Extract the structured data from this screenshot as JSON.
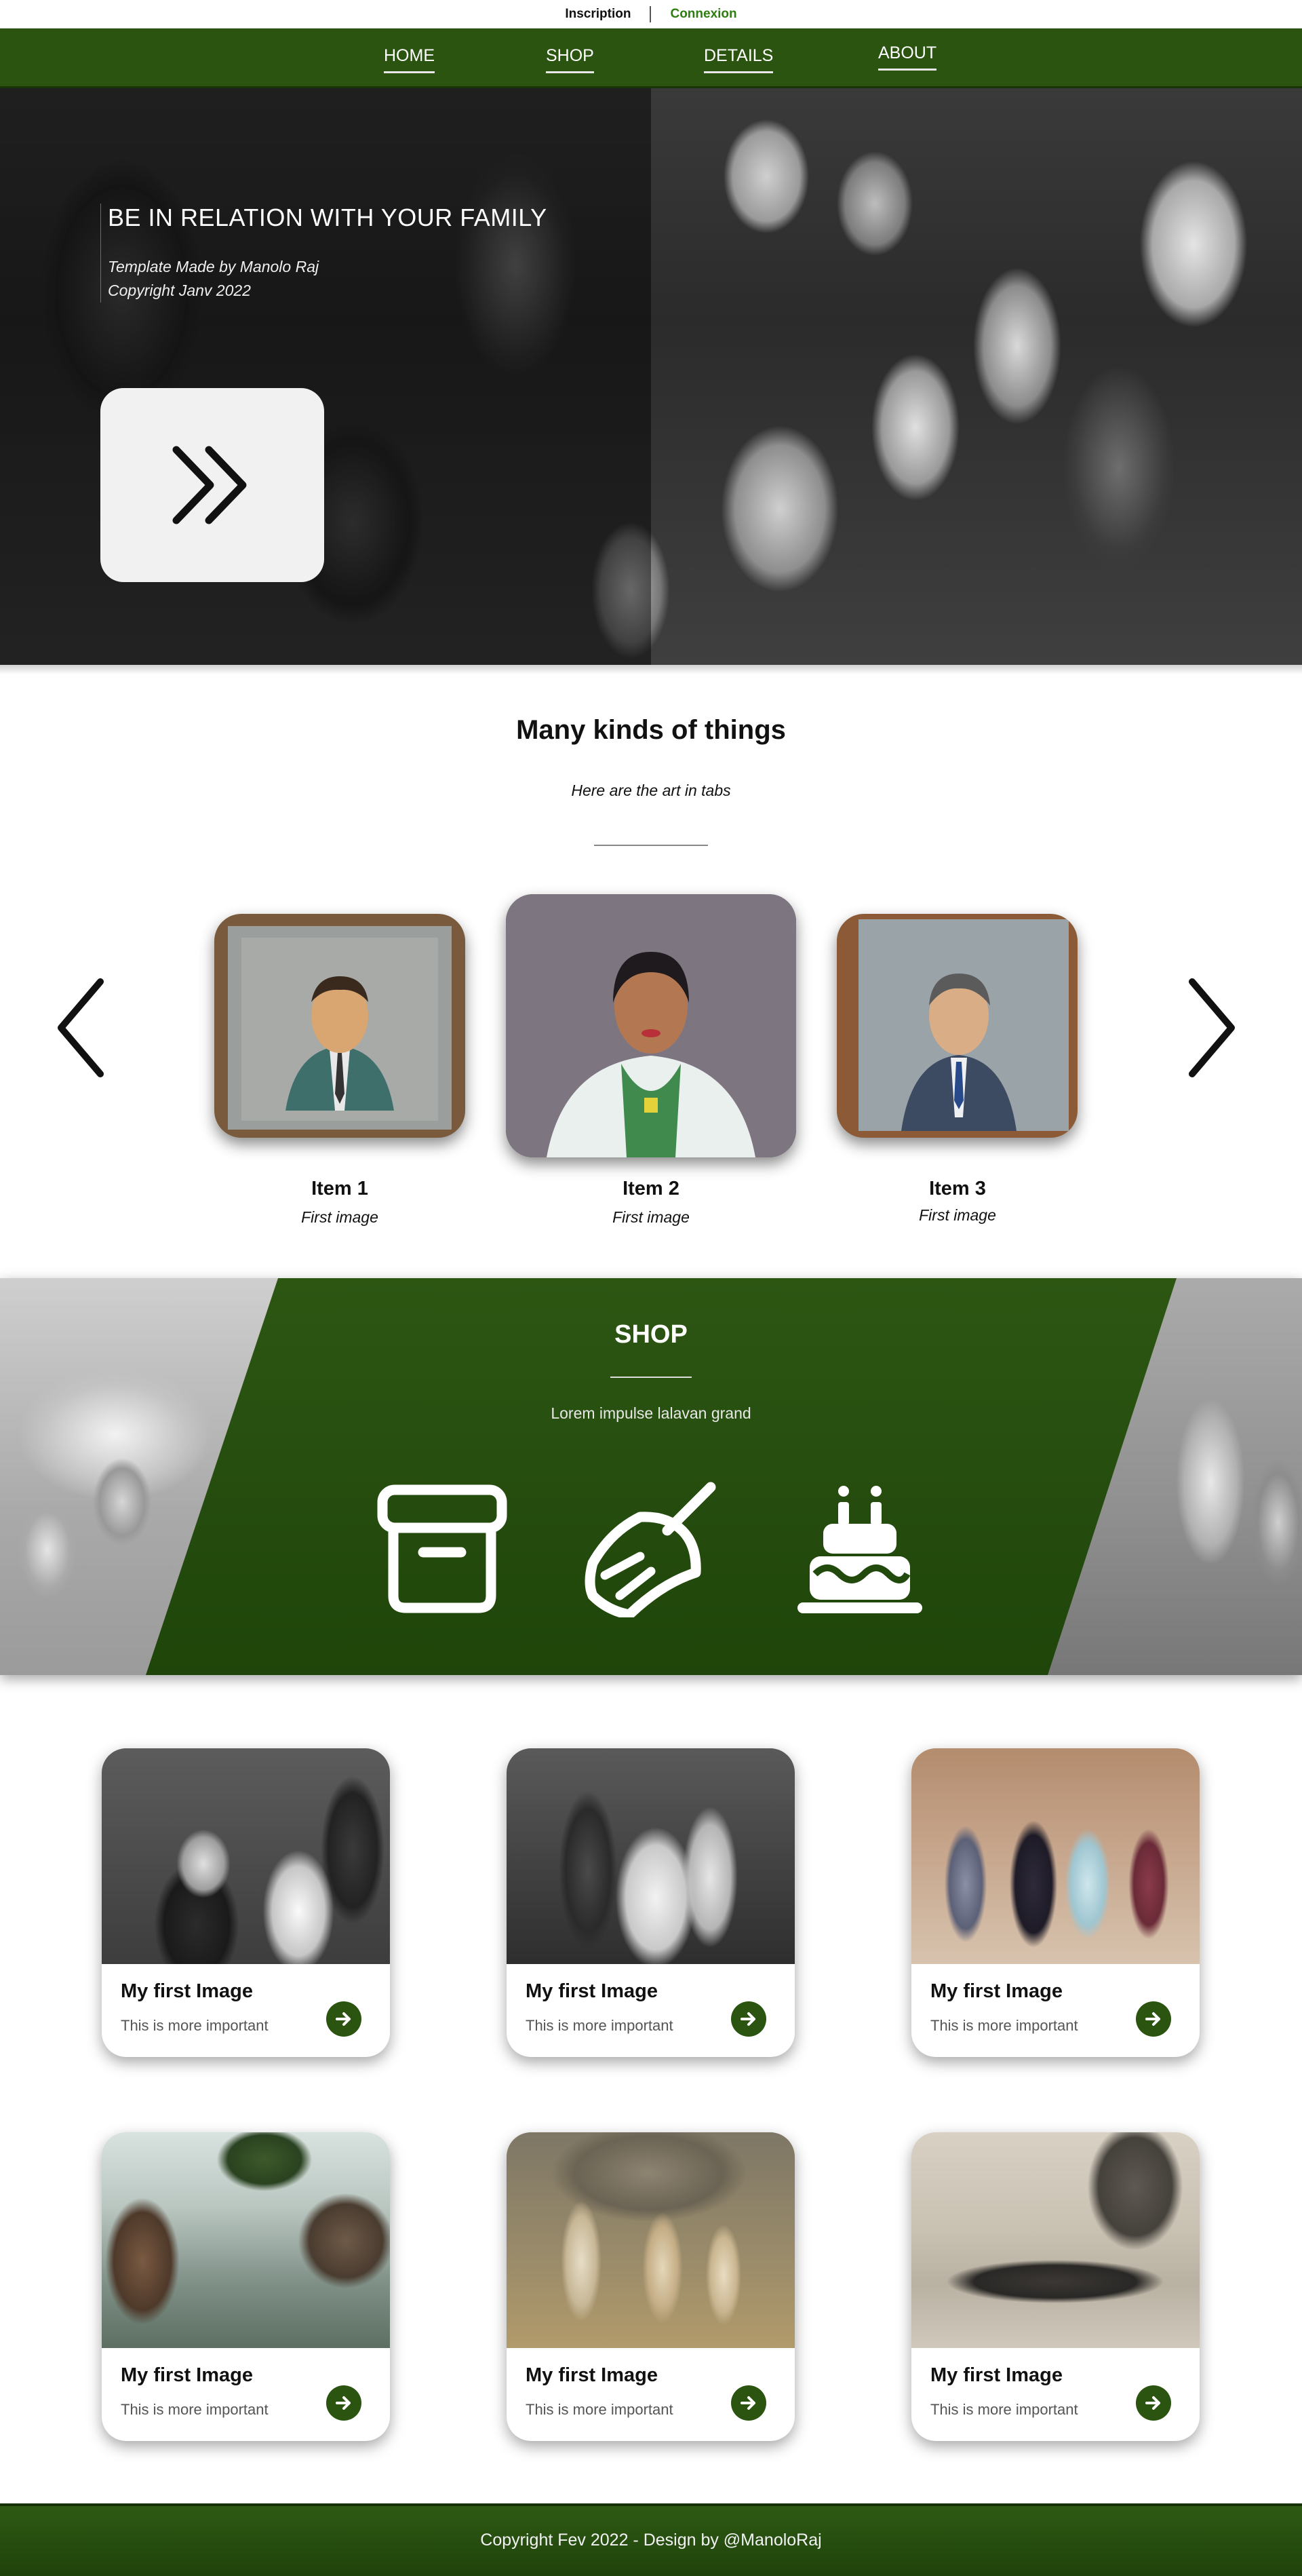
{
  "topbar": {
    "inscription": "Inscription",
    "connexion": "Connexion"
  },
  "nav": {
    "home": "HOME",
    "shop": "SHOP",
    "details": "DETAILS",
    "about": "ABOUT"
  },
  "hero": {
    "title": "BE IN RELATION WITH YOUR FAMILY",
    "subtitle_line1": "Template Made by Manolo Raj",
    "subtitle_line2": "Copyright Janv 2022",
    "button_icon": "double-chevron-right-icon"
  },
  "kinds": {
    "title": "Many kinds of things",
    "subtitle": "Here are the art in tabs",
    "prev_icon": "chevron-left-icon",
    "next_icon": "chevron-right-icon",
    "items": [
      {
        "title": "Item 1",
        "caption": "First image"
      },
      {
        "title": "Item 2",
        "caption": "First image"
      },
      {
        "title": "Item 3",
        "caption": "First image"
      }
    ]
  },
  "shop": {
    "title": "SHOP",
    "subtitle": "Lorem impulse lalavan grand",
    "icons": [
      "archive-box-icon",
      "broom-icon",
      "birthday-cake-icon"
    ]
  },
  "gallery": {
    "cards": [
      {
        "title": "My first Image",
        "subtitle": "This is more important"
      },
      {
        "title": "My first Image",
        "subtitle": "This is more important"
      },
      {
        "title": "My first Image",
        "subtitle": "This is more important"
      },
      {
        "title": "My first Image",
        "subtitle": "This is more important"
      },
      {
        "title": "My first Image",
        "subtitle": "This is more important"
      },
      {
        "title": "My first Image",
        "subtitle": "This is more important"
      }
    ]
  },
  "footer": {
    "text": "Copyright Fev 2022 - Design by @ManoloRaj"
  },
  "colors": {
    "brand_green": "#2a5410",
    "link_green": "#2f7d10",
    "hero_button_bg": "#f1f1f1"
  }
}
